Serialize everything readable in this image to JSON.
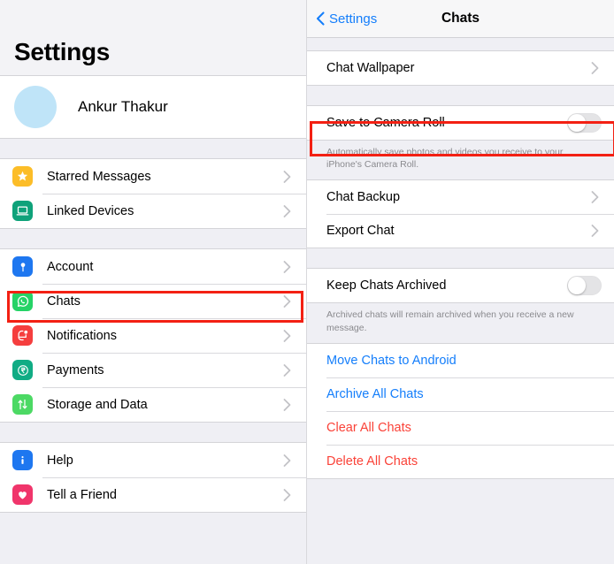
{
  "left_panel": {
    "title": "Settings",
    "profile": {
      "name": "Ankur Thakur",
      "avatar_color": "#bfe4f8"
    },
    "groups": [
      {
        "items": [
          {
            "label": "Starred Messages",
            "icon": "star-icon",
            "color": "#fcbd28"
          },
          {
            "label": "Linked Devices",
            "icon": "laptop-icon",
            "color": "#0fa27a"
          }
        ]
      },
      {
        "items": [
          {
            "label": "Account",
            "icon": "key-icon",
            "color": "#1e77f0"
          },
          {
            "label": "Chats",
            "icon": "whatsapp-chat-icon",
            "color": "#25d366"
          },
          {
            "label": "Notifications",
            "icon": "bell-notification-icon",
            "color": "#f53e3e"
          },
          {
            "label": "Payments",
            "icon": "rupee-icon",
            "color": "#10ac84"
          },
          {
            "label": "Storage and Data",
            "icon": "arrows-updown-icon",
            "color": "#4cd964"
          }
        ]
      },
      {
        "items": [
          {
            "label": "Help",
            "icon": "info-icon",
            "color": "#1e77f0"
          },
          {
            "label": "Tell a Friend",
            "icon": "heart-icon",
            "color": "#f0356b"
          }
        ]
      }
    ]
  },
  "right_panel": {
    "nav": {
      "back_label": "Settings",
      "title": "Chats"
    },
    "group_wallpaper": [
      {
        "label": "Chat Wallpaper",
        "type": "disclosure"
      }
    ],
    "group_camera": [
      {
        "label": "Save to Camera Roll",
        "type": "toggle",
        "value": "off"
      }
    ],
    "footnote_camera": "Automatically save photos and videos you receive to your iPhone's Camera Roll.",
    "group_backup": [
      {
        "label": "Chat Backup",
        "type": "disclosure"
      },
      {
        "label": "Export Chat",
        "type": "disclosure"
      }
    ],
    "group_archive": [
      {
        "label": "Keep Chats Archived",
        "type": "toggle",
        "value": "off"
      }
    ],
    "footnote_archive": "Archived chats will remain archived when you receive a new message.",
    "group_actions": [
      {
        "label": "Move Chats to Android",
        "style": "blue"
      },
      {
        "label": "Archive All Chats",
        "style": "blue"
      },
      {
        "label": "Clear All Chats",
        "style": "red"
      },
      {
        "label": "Delete All Chats",
        "style": "red"
      }
    ]
  },
  "highlights": {
    "color": "#f32013",
    "boxes": [
      {
        "target": "Chats",
        "panel": "left"
      },
      {
        "target": "Save to Camera Roll",
        "panel": "right"
      }
    ]
  }
}
